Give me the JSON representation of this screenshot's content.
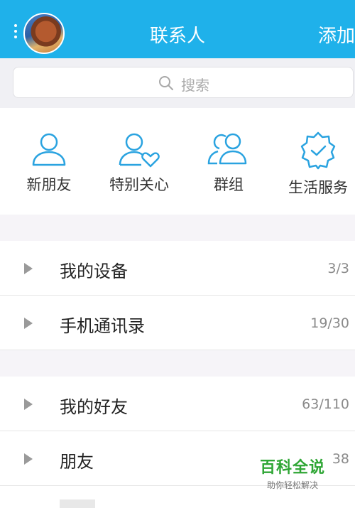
{
  "header": {
    "title": "联系人",
    "add_label": "添加"
  },
  "search": {
    "placeholder": "搜索"
  },
  "quick_actions": [
    {
      "label": "新朋友",
      "icon": "person-icon"
    },
    {
      "label": "特别关心",
      "icon": "person-heart-icon"
    },
    {
      "label": "群组",
      "icon": "group-icon"
    },
    {
      "label": "生活服务",
      "icon": "badge-check-icon"
    }
  ],
  "groups": [
    {
      "name": "我的设备",
      "count": "3/3"
    },
    {
      "name": "手机通讯录",
      "count": "19/30"
    },
    {
      "name": "我的好友",
      "count": "63/110"
    },
    {
      "name": "朋友",
      "count": "38"
    }
  ],
  "watermark": {
    "title": "百科全说",
    "subtitle": "助你轻松解决"
  },
  "colors": {
    "accent": "#1fb1ea",
    "icon": "#2aa3e0",
    "watermark": "#2fa635"
  }
}
